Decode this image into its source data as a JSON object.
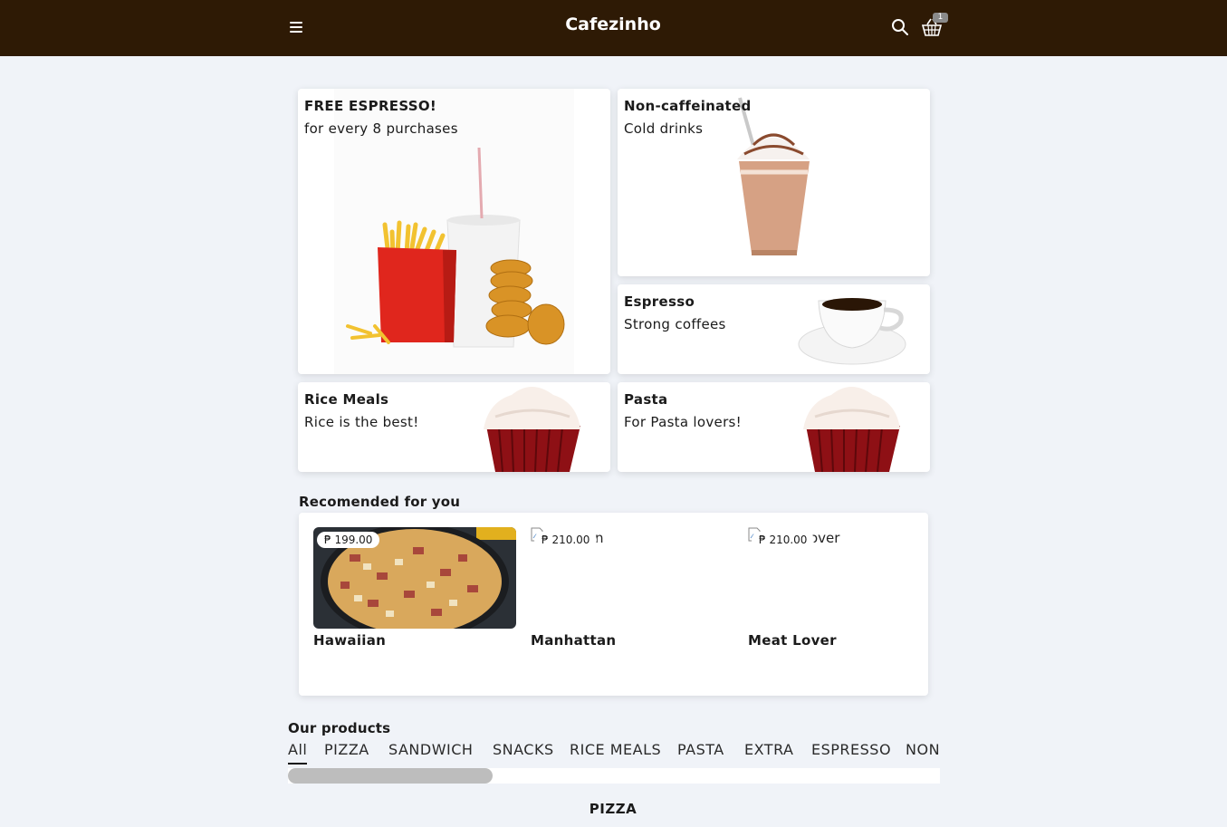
{
  "header": {
    "brand": "Cafezinho",
    "cart_count": "1"
  },
  "promo_cards": [
    {
      "title": "FREE ESPRESSO!",
      "subtitle": "for every 8 purchases"
    },
    {
      "title": "Non-caffeinated",
      "subtitle": "Cold drinks"
    },
    {
      "title": "Espresso",
      "subtitle": "Strong coffees"
    },
    {
      "title": "Rice Meals",
      "subtitle": "Rice is the best!"
    },
    {
      "title": "Pasta",
      "subtitle": "For Pasta lovers!"
    }
  ],
  "recommended": {
    "title": "Recomended for you",
    "items": [
      {
        "name": "Hawaiian",
        "price": "₱ 199.00",
        "alt_fragment": ""
      },
      {
        "name": "Manhattan",
        "price": "₱ 210.00",
        "alt_fragment": "ttan"
      },
      {
        "name": "Meat Lover",
        "price": "₱ 210.00",
        "alt_fragment": "over"
      }
    ]
  },
  "products": {
    "title": "Our products",
    "tabs": [
      "All",
      "PIZZA",
      "SANDWICH",
      "SNACKS",
      "RICE MEALS",
      "PASTA",
      "EXTRA",
      "ESPRESSO",
      "NON"
    ],
    "active_tab": "All",
    "category_heading": "PIZZA"
  },
  "colors": {
    "header_bg": "#2e1a05",
    "page_bg": "#f0f3f8"
  },
  "icons": [
    "menu-icon",
    "search-icon",
    "basket-icon",
    "broken-image-icon"
  ]
}
